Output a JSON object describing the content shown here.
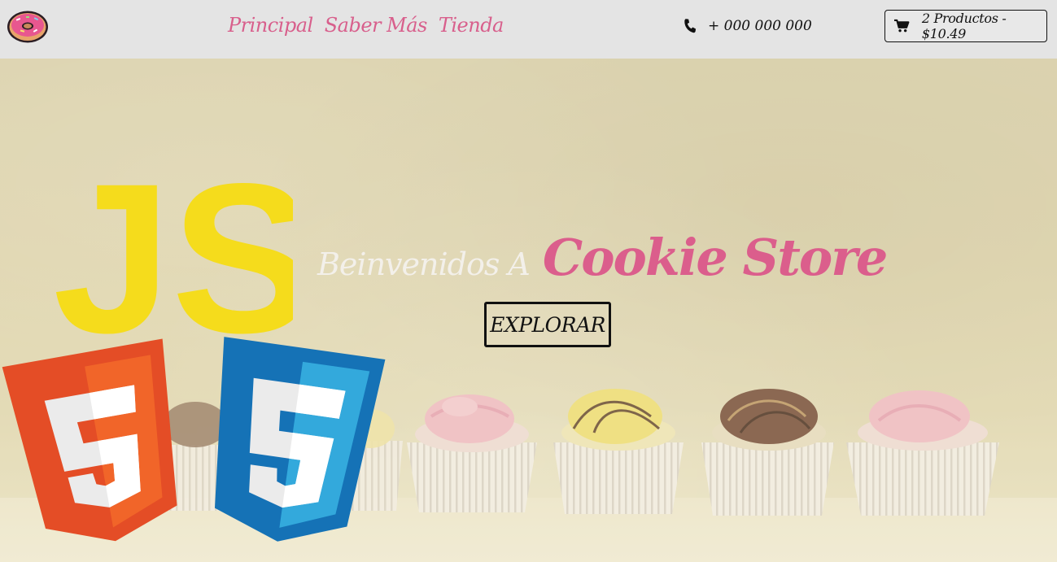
{
  "nav": {
    "links": [
      "Principal",
      "Saber Más",
      "Tienda"
    ],
    "phone": "+ 000 000 000",
    "cart": "2 Productos - $10.49"
  },
  "hero": {
    "welcome": "Beinvenidos A",
    "brand": "Cookie Store",
    "cta": "EXPLORAR"
  },
  "badges": {
    "js": "JS"
  },
  "icons": {
    "logo": "donut-icon",
    "phone": "phone-icon",
    "cart": "cart-icon"
  },
  "colors": {
    "brand_pink": "#db5e8c",
    "nav_bg": "#e4e4e4",
    "js_yellow": "#f5dc1c",
    "html5_orange": "#e44d26",
    "css3_blue": "#1572b6"
  }
}
